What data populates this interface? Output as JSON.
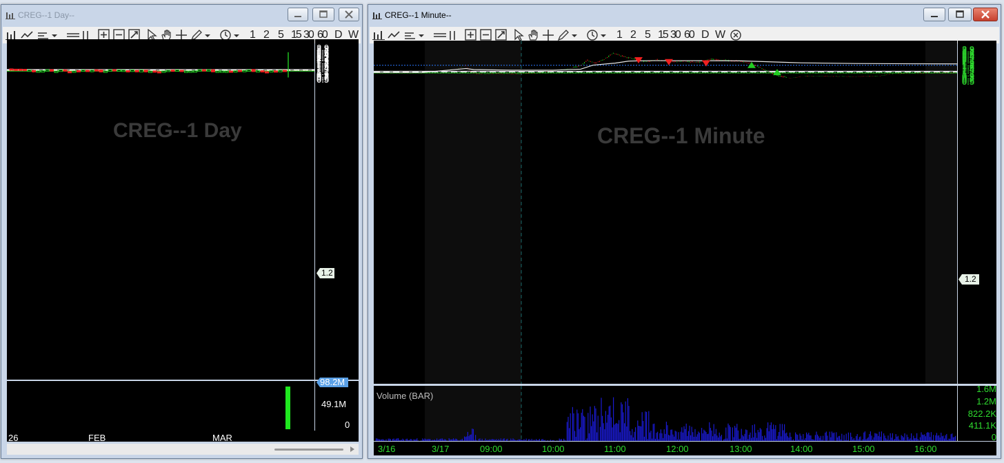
{
  "windows": [
    {
      "title": "CREG--1 Day--",
      "watermark": "CREG--1 Day",
      "price_ticks": [
        "2.9",
        "2.8",
        "2.7",
        "2.6",
        "2.5",
        "2.4",
        "2.3",
        "2.2",
        "2.1",
        "2",
        "1.9",
        "1.8",
        "1.7",
        "1.6",
        "1.5",
        "1.4",
        "1.3",
        "1.1",
        "1",
        "0.9",
        "0.8",
        "0.7",
        "0.6",
        "0.5"
      ],
      "price_tag": "1.2",
      "volume_ticks": [
        "98.2M",
        "49.1M",
        "0"
      ],
      "date_labels": [
        "26",
        "FEB",
        "MAR"
      ]
    },
    {
      "title": "CREG--1 Minute--",
      "watermark": "CREG--1 Minute",
      "price_ticks": [
        "2.9",
        "2.8",
        "2.7",
        "2.6",
        "2.5",
        "2.4",
        "2.3",
        "2.2",
        "2.1",
        "2",
        "1.9",
        "1.8",
        "1.7",
        "1.6",
        "1.5",
        "1.4",
        "1.3",
        "1.1",
        "1",
        "0.9",
        "0.8",
        "0.7",
        "0.6",
        "0.5"
      ],
      "price_tag": "1.2",
      "volume_label": "Volume (BAR)",
      "volume_ticks": [
        "1.6M",
        "1.2M",
        "822.2K",
        "411.1K",
        "0"
      ],
      "date_labels": [
        "3/16",
        "3/17",
        "09:00",
        "10:00",
        "11:00",
        "12:00",
        "13:00",
        "14:00",
        "15:00",
        "16:00"
      ]
    }
  ],
  "toolbar": {
    "intervals": [
      "1",
      "2",
      "5",
      "15",
      "30",
      "60",
      "D",
      "W"
    ]
  },
  "colors": {
    "up": "#22cc22",
    "down": "#ee2020",
    "axis_text_left": "#ffffff",
    "axis_text_right": "#2fdc2f",
    "vwap": "#e8e8e8",
    "volume": "#1a1ad0",
    "level_line": "#2a78ff",
    "titlebar": "#c9d6e8",
    "close_button": "#d9453a"
  },
  "icons": [
    "chart-icon",
    "minimize-icon",
    "maximize-icon",
    "close-icon",
    "line-chart-icon",
    "indicator-icon",
    "dropdown-icon",
    "crosshair-icon",
    "zoom-in-icon",
    "zoom-out-icon",
    "zoom-fit-icon",
    "cursor-icon",
    "hand-icon",
    "pencil-icon",
    "clock-icon",
    "close-circle-icon"
  ]
}
